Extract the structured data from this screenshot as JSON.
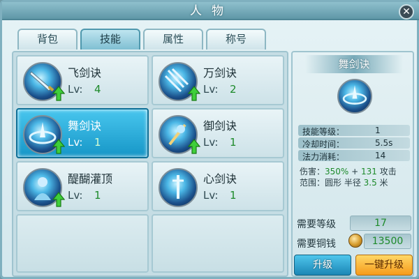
{
  "window": {
    "title": "人物",
    "close_label": "✕"
  },
  "tabs": [
    {
      "label": "背包",
      "active": false
    },
    {
      "label": "技能",
      "active": true
    },
    {
      "label": "属性",
      "active": false
    },
    {
      "label": "称号",
      "active": false
    }
  ],
  "skills": [
    {
      "name": "飞剑诀",
      "lv_label": "Lv:",
      "level": "4",
      "upgradable": true,
      "selected": false
    },
    {
      "name": "万剑诀",
      "lv_label": "Lv:",
      "level": "2",
      "upgradable": true,
      "selected": false
    },
    {
      "name": "舞剑诀",
      "lv_label": "Lv:",
      "level": "1",
      "upgradable": true,
      "selected": true
    },
    {
      "name": "御剑诀",
      "lv_label": "Lv:",
      "level": "1",
      "upgradable": true,
      "selected": false
    },
    {
      "name": "醍醐灌顶",
      "lv_label": "Lv:",
      "level": "1",
      "upgradable": true,
      "selected": false
    },
    {
      "name": "心剑诀",
      "lv_label": "Lv:",
      "level": "1",
      "upgradable": false,
      "selected": false
    }
  ],
  "detail": {
    "title": "舞剑诀",
    "stats": [
      {
        "key": "技能等级：",
        "value": "1"
      },
      {
        "key": "冷却时间：",
        "value": "5.5s"
      },
      {
        "key": "法力消耗：",
        "value": "14"
      }
    ],
    "damage": {
      "label": "伤害：",
      "pct": "350%",
      "plus": " + ",
      "flat": "131",
      "suffix": " 攻击"
    },
    "range": {
      "label": "范围：圆形 半径 ",
      "radius": "3.5",
      "unit": " 米"
    },
    "req_level_label": "需要等级",
    "req_level_value": "17",
    "req_money_label": "需要铜钱",
    "req_money_value": "13500",
    "upgrade_button": "升级",
    "oneclick_button": "一键升级"
  },
  "colors": {
    "accent": "#1696c7",
    "level_green": "#1d8a2a",
    "gold": "#f59b1b"
  }
}
